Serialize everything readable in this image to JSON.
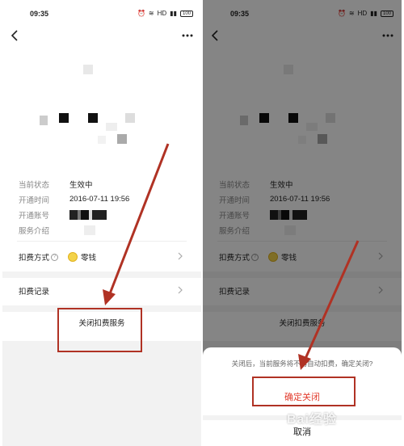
{
  "status_bar": {
    "time": "09:35",
    "network_badge": "HD",
    "battery": "100"
  },
  "info": {
    "rows": [
      {
        "label": "当前状态",
        "value": "生效中"
      },
      {
        "label": "开通时间",
        "value": "2016-07-11 19:56"
      },
      {
        "label": "开通账号",
        "value": ""
      },
      {
        "label": "服务介绍",
        "value": ""
      }
    ]
  },
  "payment": {
    "label": "扣费方式",
    "method": "零钱"
  },
  "records": {
    "label": "扣费记录"
  },
  "close_service_label": "关闭扣费服务",
  "sheet": {
    "message": "关闭后，当前服务将不再自动扣费，确定关闭?",
    "confirm_label": "确定关闭",
    "cancel_label": "取消"
  },
  "watermark": "Bai经验",
  "colors": {
    "annotation_red": "#b03224",
    "confirm_red": "#e23b2c",
    "coin": "#f3d34a",
    "overlay": "rgba(0,0,0,0.48)"
  },
  "icons": [
    "back-icon",
    "more-icon",
    "help-icon",
    "coin-icon",
    "chevron-right-icon",
    "wifi-icon",
    "signal-icon",
    "battery-icon",
    "alarm-icon"
  ]
}
